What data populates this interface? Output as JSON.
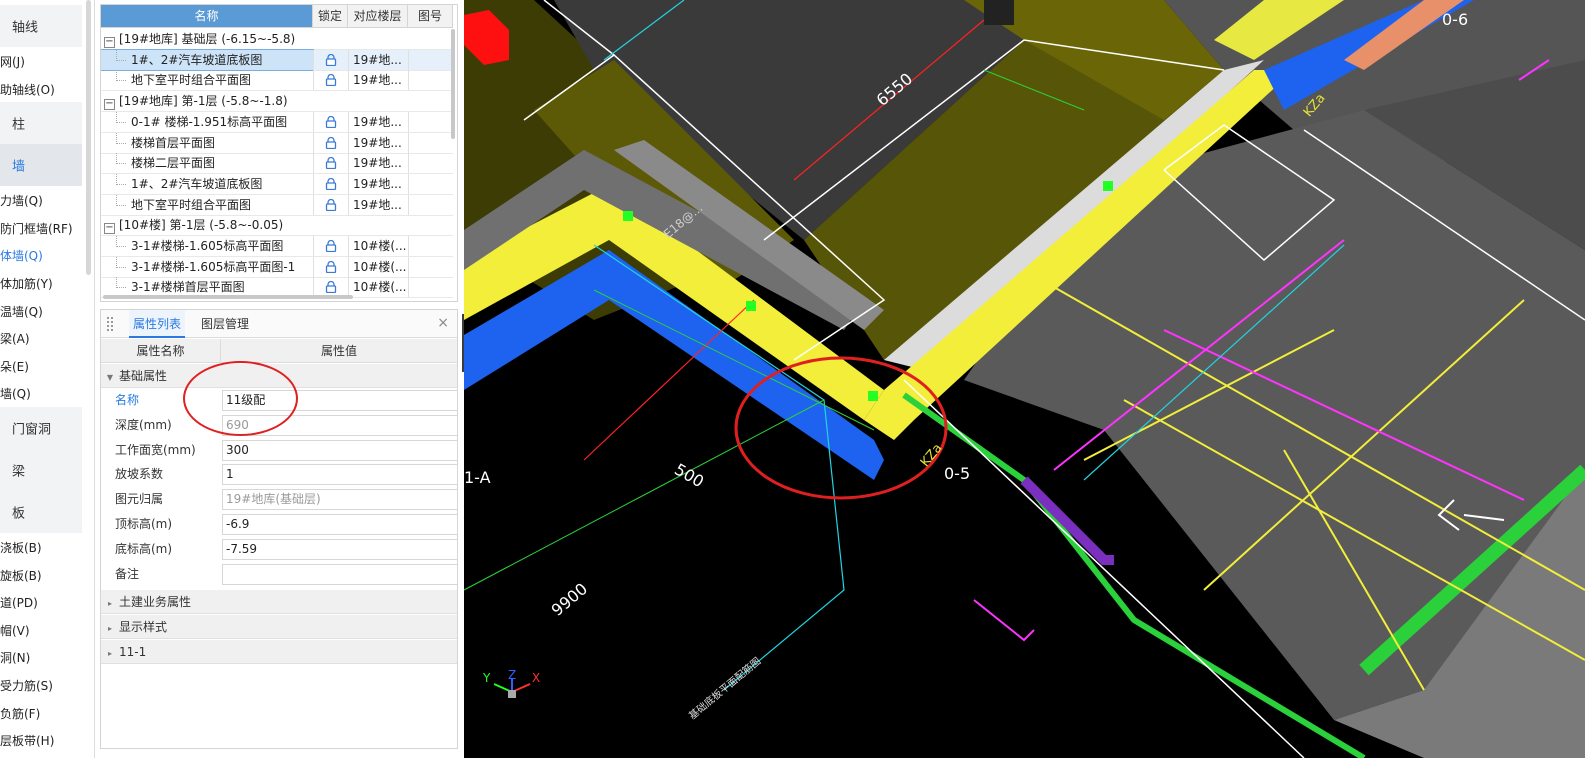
{
  "left_nav": {
    "items": [
      {
        "type": "category",
        "label": "轴线"
      },
      {
        "type": "item",
        "label": "网(J)"
      },
      {
        "type": "item",
        "label": "助轴线(O)"
      },
      {
        "type": "category",
        "label": "柱"
      },
      {
        "type": "category",
        "label": "墙",
        "selected": true
      },
      {
        "type": "item",
        "label": "力墙(Q)"
      },
      {
        "type": "item",
        "label": "防门框墙(RF)"
      },
      {
        "type": "item",
        "label": "体墙(Q)",
        "active": true
      },
      {
        "type": "item",
        "label": "体加筋(Y)"
      },
      {
        "type": "item",
        "label": "温墙(Q)"
      },
      {
        "type": "item",
        "label": "梁(A)"
      },
      {
        "type": "item",
        "label": "朵(E)"
      },
      {
        "type": "item",
        "label": "墙(Q)"
      },
      {
        "type": "category",
        "label": "门窗洞"
      },
      {
        "type": "category",
        "label": "梁"
      },
      {
        "type": "category",
        "label": "板"
      },
      {
        "type": "item",
        "label": "浇板(B)"
      },
      {
        "type": "item",
        "label": "旋板(B)"
      },
      {
        "type": "item",
        "label": "道(PD)"
      },
      {
        "type": "item",
        "label": "帽(V)"
      },
      {
        "type": "item",
        "label": "洞(N)"
      },
      {
        "type": "item",
        "label": "受力筋(S)"
      },
      {
        "type": "item",
        "label": "负筋(F)"
      },
      {
        "type": "item",
        "label": "层板带(H)"
      }
    ]
  },
  "drawing_tree": {
    "columns": [
      "名称",
      "锁定",
      "对应楼层",
      "图号"
    ],
    "rows": [
      {
        "kind": "group",
        "expander": "−",
        "name": "[19#地库] 基础层 (-6.15~-5.8)"
      },
      {
        "kind": "item",
        "name": "1#、2#汽车坡道底板图",
        "floor": "19#地...",
        "selected": true
      },
      {
        "kind": "item",
        "name": "地下室平时组合平面图",
        "floor": "19#地..."
      },
      {
        "kind": "group",
        "expander": "−",
        "name": "[19#地库] 第-1层 (-5.8~-1.8)"
      },
      {
        "kind": "item",
        "name": "0-1# 楼梯-1.951标高平面图",
        "floor": "19#地..."
      },
      {
        "kind": "item",
        "name": "楼梯首层平面图",
        "floor": "19#地..."
      },
      {
        "kind": "item",
        "name": "楼梯二层平面图",
        "floor": "19#地..."
      },
      {
        "kind": "item",
        "name": "1#、2#汽车坡道底板图",
        "floor": "19#地..."
      },
      {
        "kind": "item",
        "name": "地下室平时组合平面图",
        "floor": "19#地..."
      },
      {
        "kind": "group",
        "expander": "−",
        "name": "[10#楼] 第-1层 (-5.8~-0.05)"
      },
      {
        "kind": "item",
        "name": "3-1#楼梯-1.605标高平面图",
        "floor": "10#楼(..."
      },
      {
        "kind": "item",
        "name": "3-1#楼梯-1.605标高平面图-1",
        "floor": "10#楼(..."
      },
      {
        "kind": "item",
        "name": "3-1#楼梯首层平面图",
        "floor": "10#楼(..."
      }
    ]
  },
  "properties": {
    "tabs": [
      "属性列表",
      "图层管理"
    ],
    "active_tab": "属性列表",
    "close_label": "×",
    "col_name": "属性名称",
    "col_value": "属性值",
    "section_basic": "基础属性",
    "fields": [
      {
        "name": "名称",
        "value": "11级配",
        "highlight": true
      },
      {
        "name": "深度(mm)",
        "value": "690",
        "readonly": true
      },
      {
        "name": "工作面宽(mm)",
        "value": "300"
      },
      {
        "name": "放坡系数",
        "value": "1"
      },
      {
        "name": "图元归属",
        "value": "19#地库(基础层)",
        "readonly": true
      },
      {
        "name": "顶标高(m)",
        "value": "-6.9"
      },
      {
        "name": "底标高(m)",
        "value": "-7.59"
      },
      {
        "name": "备注",
        "value": ""
      }
    ],
    "collapsed_sections": [
      "土建业务属性",
      "显示样式",
      "11-1"
    ]
  },
  "viewport": {
    "labels": {
      "dim_6550": "6550",
      "dim_500": "500",
      "dim_9900": "9900",
      "axis_05": "0-5",
      "axis_06": "0-6",
      "axis_1a": "1-A",
      "col_kz_a": "KZa",
      "col_kz_b": "KZa",
      "rebar": "E18@...",
      "drawing_note": "基础底板平面配筋图"
    },
    "axes": {
      "x": "X",
      "y": "Y",
      "z": "Z"
    },
    "colors": {
      "background": "#000000",
      "wall_yellow": "#f2ee3a",
      "wall_blue": "#1e63f0",
      "slab_olive": "#5a5806",
      "slab_gray": "#4a4a4a",
      "highlight_circle": "#e02020",
      "magenta": "#ff33ff",
      "green_edge": "#2bd13a"
    }
  }
}
